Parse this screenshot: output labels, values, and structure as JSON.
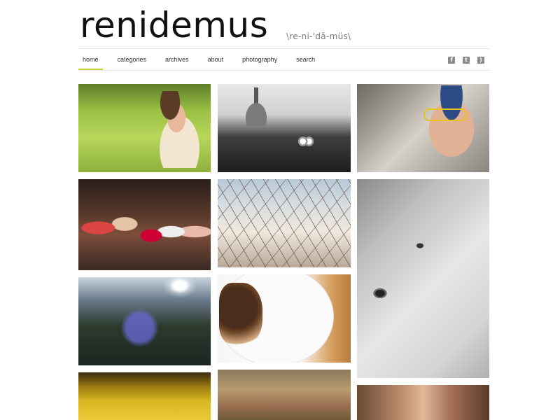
{
  "header": {
    "site_title": "renidemus",
    "pronunciation": "\\re-ni-'dā-müs\\"
  },
  "nav": {
    "items": [
      {
        "label": "home",
        "active": true
      },
      {
        "label": "categories"
      },
      {
        "label": "archives"
      },
      {
        "label": "about"
      },
      {
        "label": "photography"
      },
      {
        "label": "search"
      }
    ]
  },
  "social": {
    "icons": [
      "facebook-icon",
      "twitter-icon",
      "rss-icon"
    ],
    "icon_color": "#8b8b8b"
  },
  "colors": {
    "accent": "#c9d63a",
    "rule": "#e6e6e6",
    "title": "#111111"
  },
  "gallery": {
    "photos": [
      {
        "subject": "girl in grass"
      },
      {
        "subject": "ring on table"
      },
      {
        "subject": "man with yellow glasses"
      },
      {
        "subject": "family group"
      },
      {
        "subject": "flowering branches"
      },
      {
        "subject": "baby close-up"
      },
      {
        "subject": "sunlit trees"
      },
      {
        "subject": "cake on plate"
      },
      {
        "subject": "yellow leaves"
      },
      {
        "subject": "autumn trees"
      },
      {
        "subject": "two children"
      }
    ]
  }
}
